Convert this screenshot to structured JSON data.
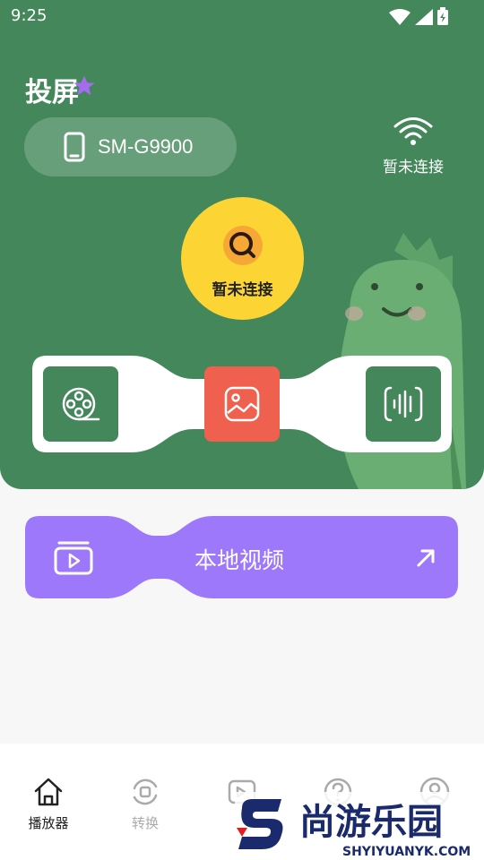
{
  "status_bar": {
    "time": "9:25"
  },
  "header": {
    "title": "投屏"
  },
  "device": {
    "name": "SM-G9900"
  },
  "wifi": {
    "status": "暂未连接"
  },
  "connect_button": {
    "label": "暂未连接"
  },
  "media_tiles": [
    {
      "icon": "film-reel-icon"
    },
    {
      "icon": "picture-icon"
    },
    {
      "icon": "audio-wave-icon"
    }
  ],
  "local_video": {
    "label": "本地视频"
  },
  "tabs": [
    {
      "label": "播放器",
      "icon": "home-icon",
      "active": true
    },
    {
      "label": "转换",
      "icon": "convert-icon",
      "active": false
    },
    {
      "label": "",
      "icon": "video-edit-icon",
      "active": false
    },
    {
      "label": "",
      "icon": "help-icon",
      "active": false
    },
    {
      "label": "",
      "icon": "user-icon",
      "active": false
    }
  ],
  "watermark": {
    "brand": "尚游乐园",
    "url": "SHYIYUANYK.COM"
  },
  "colors": {
    "green": "#43875a",
    "yellow": "#fcd535",
    "coral": "#f0604e",
    "purple": "#9d78fb"
  }
}
